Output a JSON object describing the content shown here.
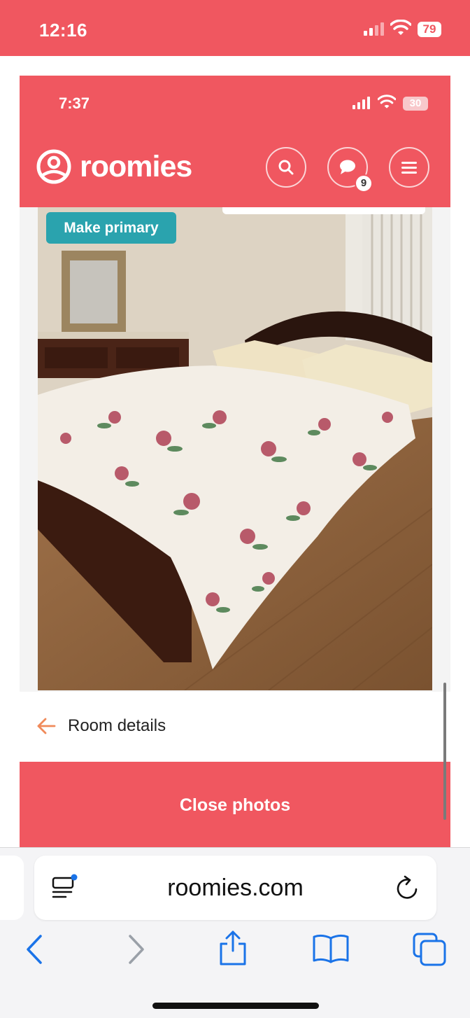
{
  "device_status": {
    "time": "12:16",
    "battery": "79"
  },
  "app_status": {
    "time": "7:37",
    "battery": "30"
  },
  "header": {
    "logo_text": "roomies",
    "chat_badge_count": "9",
    "icons": [
      "search-icon",
      "chat-bubble-icon",
      "menu-icon"
    ]
  },
  "photo": {
    "make_primary_label": "Make primary"
  },
  "room_details": {
    "label": "Room details"
  },
  "close_photos": {
    "label": "Close photos"
  },
  "browser": {
    "url": "roomies.com"
  },
  "colors": {
    "brand": "#F05760",
    "accent_teal": "#2AA3AE",
    "link_blue": "#1a73e8"
  }
}
